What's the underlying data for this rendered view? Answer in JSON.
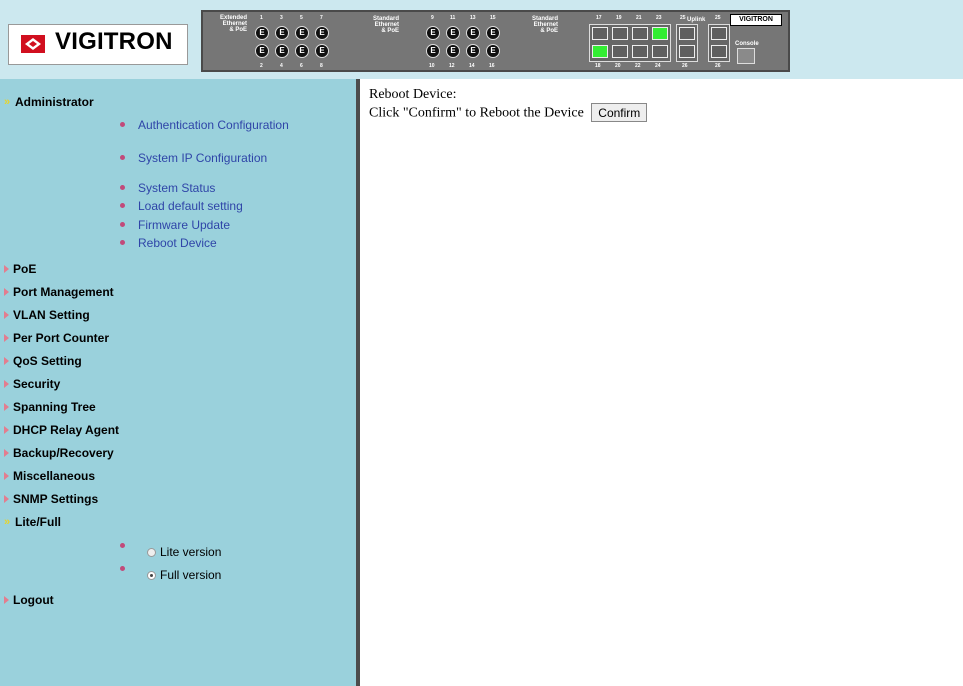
{
  "header": {
    "logo_text": "VIGITRON",
    "panel": {
      "group1": [
        "Extended",
        "Ethernet",
        "& PoE"
      ],
      "group2": [
        "Standard",
        "Ethernet",
        "& PoE"
      ],
      "group3": [
        "Standard",
        "Ethernet",
        "& PoE"
      ],
      "uplink_label": "Uplink",
      "console_label": "Console",
      "mini_logo": "VIGITRON",
      "top_numbers": [
        "1",
        "3",
        "5",
        "7",
        "9",
        "11",
        "13",
        "15",
        "17",
        "19",
        "21",
        "23",
        "25",
        "25"
      ],
      "bottom_numbers": [
        "2",
        "4",
        "6",
        "8",
        "10",
        "12",
        "14",
        "16",
        "18",
        "20",
        "22",
        "24",
        "26",
        "26"
      ]
    }
  },
  "sidebar": {
    "administrator": "Administrator",
    "admin_items": [
      "Authentication Configuration",
      "System IP Configuration",
      "System Status",
      "Load default setting",
      "Firmware Update",
      "Reboot Device"
    ],
    "menus": [
      "PoE",
      "Port Management",
      "VLAN Setting",
      "Per Port Counter",
      "QoS Setting",
      "Security",
      "Spanning Tree",
      "DHCP Relay Agent",
      "Backup/Recovery",
      "Miscellaneous",
      "SNMP Settings"
    ],
    "lite_full": "Lite/Full",
    "lite_label": "Lite version",
    "full_label": "Full version",
    "logout": "Logout"
  },
  "content": {
    "title": "Reboot Device:",
    "instruction": "Click \"Confirm\" to Reboot the Device",
    "confirm_label": "Confirm"
  },
  "colors": {
    "sidebar": "#9ad1dc",
    "header": "#cce8ef",
    "link": "#2f45a8",
    "active_port": "#33ee33"
  }
}
